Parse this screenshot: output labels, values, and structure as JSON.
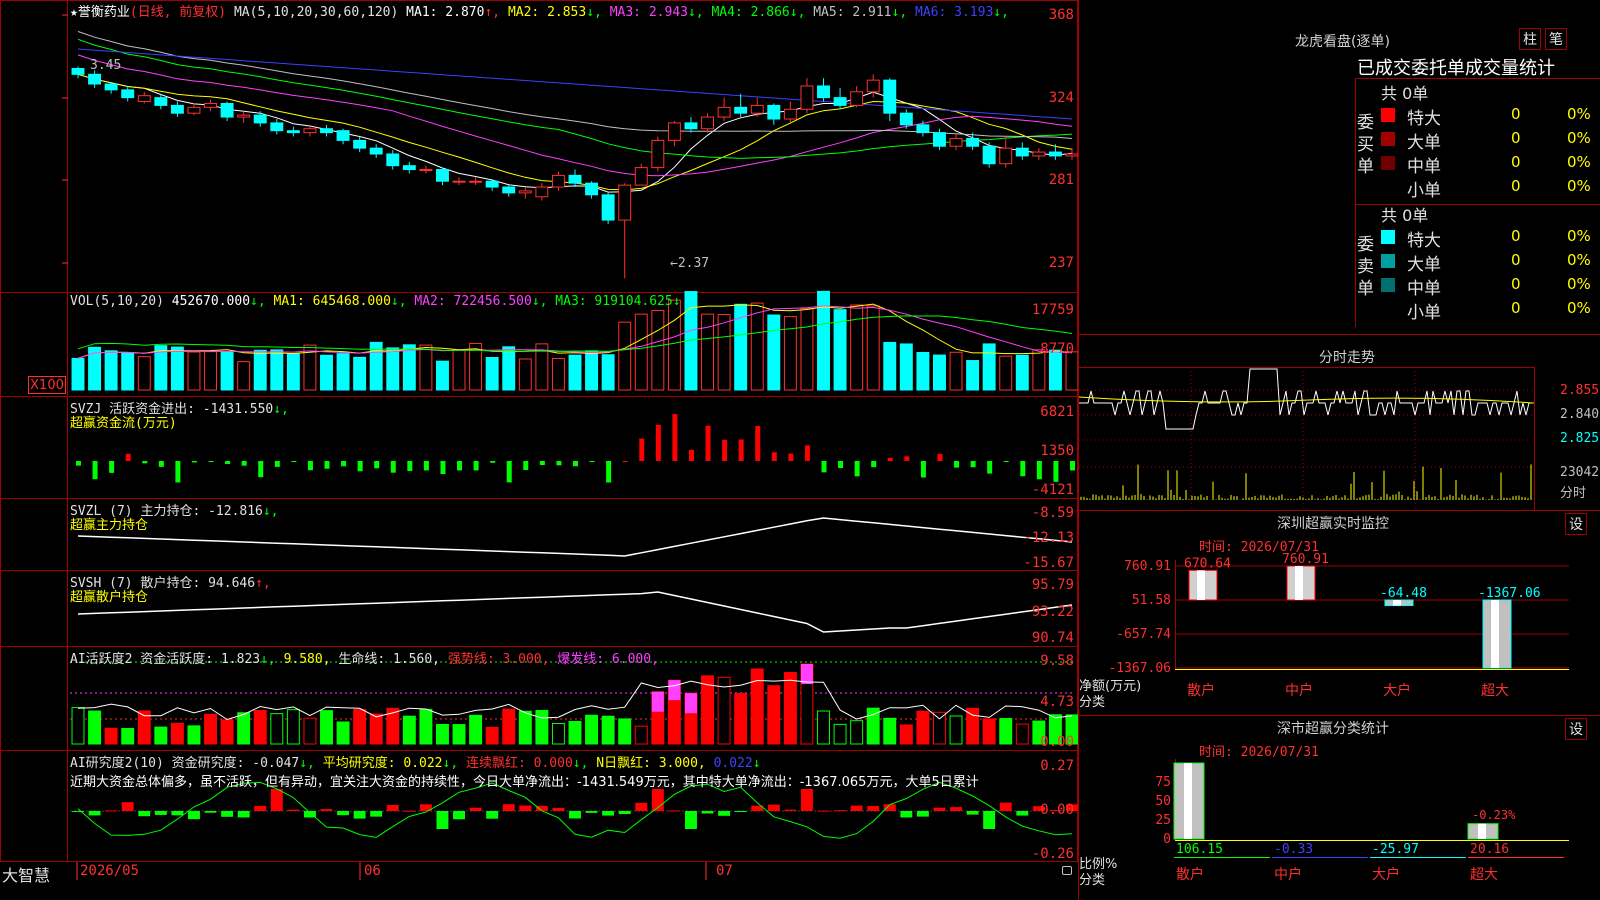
{
  "header": {
    "stock": "★誉衡药业",
    "mode": "(日线, 前复权)",
    "ma_label": "MA(5,10,20,30,60,120)",
    "ma": [
      {
        "label": "MA1: 2.870",
        "arrow": "↑",
        "color": "#ffffff"
      },
      {
        "label": "MA2: 2.853",
        "arrow": "↓",
        "color": "#ffff00"
      },
      {
        "label": "MA3: 2.943",
        "arrow": "↓",
        "color": "#ff40ff"
      },
      {
        "label": "MA4: 2.866",
        "arrow": "↓",
        "color": "#00ff00"
      },
      {
        "label": "MA5: 2.911",
        "arrow": "↓",
        "color": "#c0c0c0"
      },
      {
        "label": "MA6: 3.193",
        "arrow": "↓",
        "color": "#4040ff"
      }
    ]
  },
  "price_axis": [
    "368",
    "324",
    "281",
    "237"
  ],
  "price_annotations": {
    "high": "3.45",
    "low": "←2.37"
  },
  "vol": {
    "title": "VOL(5,10,20)",
    "value": "452670.000",
    "ma1": "MA1: 645468.000",
    "ma2": "MA2: 722456.500",
    "ma3": "MA3: 919104.625",
    "axis": [
      "17759",
      "8770"
    ],
    "unit": "X100"
  },
  "svzj": {
    "title": "SVZJ  活跃资金进出: -1431.550",
    "subtitle": "超赢资金流(万元)",
    "axis": [
      "6821",
      "1350",
      "-4121"
    ]
  },
  "svzl": {
    "title": "SVZL (7) 主力持仓: -12.816",
    "subtitle": "超赢主力持仓",
    "axis": [
      "-8.59",
      "-12.13",
      "-15.67"
    ]
  },
  "svsh": {
    "title": "SVSH (7) 散户持仓: 94.646",
    "subtitle": "超赢散户持仓",
    "axis": [
      "95.79",
      "93.22",
      "90.74"
    ]
  },
  "ai_act": {
    "title": "AI活跃度2 资金活跃度: 1.823",
    "v2": "9.580",
    "v3": "生命线: 1.560,",
    "v4": "强势线: 3.000,",
    "v5": "爆发线: 6.000,",
    "axis": [
      "9.58",
      "4.73",
      "0.00"
    ]
  },
  "ai_res": {
    "title": "AI研究度2(10) 资金研究度: -0.047",
    "v2": "平均研究度: 0.022",
    "v3": "连续飘红: 0.000",
    "v4": "N日飘红: 3.000,",
    "v5": "0.022",
    "text": "近期大资金总体偏多，虽不活跃，但有异动，宜关注大资金的持续性，今日大单净流出：-1431.549万元，其中特大单净流出：-1367.065万元，大单5日累计",
    "axis": [
      "0.27",
      "0.00",
      "-0.26"
    ]
  },
  "date_axis": {
    "brand": "大智慧",
    "labels": [
      "2026/05",
      "06",
      "07"
    ]
  },
  "lhb": {
    "title": "龙虎看盘(逐单)",
    "btn1": "柱",
    "btn2": "笔",
    "subtitle": "已成交委托单成交量统计",
    "buy": {
      "side": "委买单",
      "total": "共 0单",
      "rows": [
        {
          "name": "特大",
          "count": "0",
          "pct": "0%",
          "color": "#ff0000"
        },
        {
          "name": "大单",
          "count": "0",
          "pct": "0%",
          "color": "#a00000"
        },
        {
          "name": "中单",
          "count": "0",
          "pct": "0%",
          "color": "#700000"
        },
        {
          "name": "小单",
          "count": "0",
          "pct": "0%",
          "color": ""
        }
      ]
    },
    "sell": {
      "side": "委卖单",
      "total": "共 0单",
      "rows": [
        {
          "name": "特大",
          "count": "0",
          "pct": "0%",
          "color": "#00ffff"
        },
        {
          "name": "大单",
          "count": "0",
          "pct": "0%",
          "color": "#00a0a0"
        },
        {
          "name": "中单",
          "count": "0",
          "pct": "0%",
          "color": "#007070"
        },
        {
          "name": "小单",
          "count": "0",
          "pct": "0%",
          "color": ""
        }
      ]
    }
  },
  "intraday": {
    "title": "分时走势",
    "axis": [
      "2.855",
      "2.840",
      "2.825"
    ],
    "vol": "23042",
    "label": "分时"
  },
  "monitor": {
    "title": "深圳超赢实时监控",
    "btn": "设",
    "time": "时间: 2026/07/31",
    "axis": [
      "760.91",
      "51.58",
      "-657.74",
      "-1367.06"
    ],
    "ylabel1": "净额(万元)",
    "ylabel2": "分类",
    "bars": [
      {
        "cat": "散户",
        "value": 670.64,
        "label": "670.64"
      },
      {
        "cat": "中户",
        "value": 760.91,
        "label": "760.91"
      },
      {
        "cat": "大户",
        "value": -64.48,
        "label": "-64.48"
      },
      {
        "cat": "超大",
        "value": -1367.06,
        "label": "-1367.06"
      }
    ]
  },
  "classify": {
    "title": "深市超赢分类统计",
    "btn": "设",
    "time": "时间: 2026/07/31",
    "axis": [
      "75",
      "50",
      "25",
      "0"
    ],
    "ylabel1": "比例%",
    "ylabel2": "分类",
    "bars": [
      {
        "cat": "散户",
        "value": 106.15,
        "label": "106.15"
      },
      {
        "cat": "中户",
        "value": -0.33,
        "label": "-0.33"
      },
      {
        "cat": "大户",
        "value": -25.97,
        "label": "-25.97"
      },
      {
        "cat": "超大",
        "value": 20.16,
        "label": "20.16"
      }
    ],
    "note": "-0.23%"
  },
  "chart_data": {
    "type": "candlestick",
    "candles": [
      [
        3.45,
        3.42,
        3.46,
        3.4
      ],
      [
        3.42,
        3.37,
        3.44,
        3.35
      ],
      [
        3.37,
        3.34,
        3.38,
        3.32
      ],
      [
        3.34,
        3.3,
        3.36,
        3.28
      ],
      [
        3.28,
        3.31,
        3.33,
        3.27
      ],
      [
        3.3,
        3.26,
        3.32,
        3.24
      ],
      [
        3.26,
        3.22,
        3.28,
        3.2
      ],
      [
        3.22,
        3.25,
        3.27,
        3.21
      ],
      [
        3.25,
        3.27,
        3.29,
        3.23
      ],
      [
        3.27,
        3.2,
        3.28,
        3.18
      ],
      [
        3.2,
        3.21,
        3.23,
        3.17
      ],
      [
        3.21,
        3.17,
        3.23,
        3.15
      ],
      [
        3.17,
        3.13,
        3.19,
        3.11
      ],
      [
        3.13,
        3.12,
        3.15,
        3.1
      ],
      [
        3.12,
        3.14,
        3.16,
        3.1
      ],
      [
        3.14,
        3.12,
        3.16,
        3.1
      ],
      [
        3.13,
        3.08,
        3.14,
        3.06
      ],
      [
        3.08,
        3.04,
        3.1,
        3.02
      ],
      [
        3.04,
        3.01,
        3.06,
        2.99
      ],
      [
        3.01,
        2.95,
        3.03,
        2.93
      ],
      [
        2.95,
        2.93,
        2.97,
        2.91
      ],
      [
        2.93,
        2.93,
        2.95,
        2.91
      ],
      [
        2.93,
        2.87,
        2.94,
        2.85
      ],
      [
        2.87,
        2.87,
        2.89,
        2.85
      ],
      [
        2.87,
        2.87,
        2.89,
        2.85
      ],
      [
        2.87,
        2.84,
        2.88,
        2.82
      ],
      [
        2.84,
        2.81,
        2.85,
        2.79
      ],
      [
        2.81,
        2.82,
        2.84,
        2.78
      ],
      [
        2.79,
        2.84,
        2.86,
        2.77
      ],
      [
        2.84,
        2.9,
        2.92,
        2.82
      ],
      [
        2.9,
        2.86,
        2.93,
        2.84
      ],
      [
        2.86,
        2.8,
        2.87,
        2.78
      ],
      [
        2.8,
        2.67,
        2.81,
        2.65
      ],
      [
        2.67,
        2.85,
        2.86,
        2.37
      ],
      [
        2.85,
        2.94,
        2.96,
        2.85
      ],
      [
        2.94,
        3.08,
        3.1,
        2.92
      ],
      [
        3.08,
        3.17,
        3.18,
        3.05
      ],
      [
        3.17,
        3.14,
        3.2,
        3.12
      ],
      [
        3.14,
        3.2,
        3.22,
        3.12
      ],
      [
        3.2,
        3.25,
        3.3,
        3.18
      ],
      [
        3.25,
        3.22,
        3.32,
        3.2
      ],
      [
        3.22,
        3.26,
        3.3,
        3.2
      ],
      [
        3.26,
        3.19,
        3.27,
        3.16
      ],
      [
        3.19,
        3.24,
        3.28,
        3.17
      ],
      [
        3.24,
        3.36,
        3.4,
        3.22
      ],
      [
        3.36,
        3.3,
        3.4,
        3.28
      ],
      [
        3.3,
        3.26,
        3.35,
        3.24
      ],
      [
        3.26,
        3.33,
        3.36,
        3.25
      ],
      [
        3.33,
        3.39,
        3.42,
        3.3
      ],
      [
        3.39,
        3.22,
        3.4,
        3.18
      ],
      [
        3.22,
        3.16,
        3.24,
        3.14
      ],
      [
        3.16,
        3.12,
        3.18,
        3.1
      ],
      [
        3.12,
        3.05,
        3.14,
        3.03
      ],
      [
        3.05,
        3.09,
        3.11,
        3.03
      ],
      [
        3.09,
        3.05,
        3.12,
        3.03
      ],
      [
        3.05,
        2.96,
        3.07,
        2.94
      ],
      [
        2.96,
        3.04,
        3.1,
        2.94
      ],
      [
        3.04,
        3.0,
        3.07,
        2.98
      ],
      [
        3.0,
        3.02,
        3.04,
        2.98
      ],
      [
        3.02,
        3.0,
        3.06,
        2.98
      ],
      [
        3.0,
        3.01,
        3.04,
        2.98
      ]
    ],
    "ylim": [
      2.3,
      3.72
    ]
  }
}
